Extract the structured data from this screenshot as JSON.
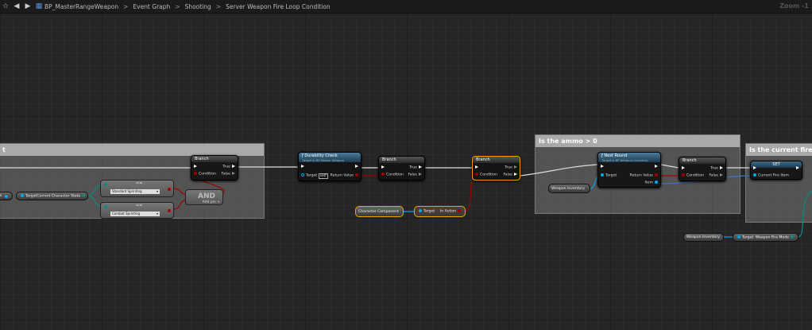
{
  "toolbar": {
    "breadcrumb": [
      "BP_MasterRangeWeapon",
      "Event Graph",
      "Shooting",
      "Server Weapon Fire Loop Condition"
    ],
    "zoom": "Zoom -1"
  },
  "comments": [
    {
      "title": "t"
    },
    {
      "title": "Is the ammo > 0"
    },
    {
      "title": "Is the current fire on"
    }
  ],
  "nodes": {
    "branch": {
      "title": "Branch",
      "condition": "Condition",
      "true": "True",
      "false": "False"
    },
    "var_cut": "rs",
    "get_state": {
      "target": "Target",
      "out": "Current Character State"
    },
    "eq1": {
      "symbol": "==",
      "value": "Standard Sprinting"
    },
    "eq2": {
      "symbol": "==",
      "value": "Combat Sprinting"
    },
    "and": {
      "title": "AND",
      "add_pin": "Add pin"
    },
    "durability": {
      "title": "Durability Check",
      "subtitle": "Target is BP Master Weapon",
      "target": "Target",
      "self": "self",
      "ret": "Return Value"
    },
    "char_comp": "Character Component",
    "in_action": {
      "target": "Target",
      "out": "In Action"
    },
    "next_round": {
      "title": "Next Round",
      "subtitle": "Target is BP Weapon Inventory",
      "target": "Target",
      "ret": "Return Value",
      "item": "Item"
    },
    "weapon_inventory": "Weapon Inventory",
    "set": {
      "title": "SET",
      "pin": "Current Fire Item"
    },
    "fire_mode": {
      "target": "Target",
      "out": "Weapon Fire Mode"
    }
  },
  "colors": {
    "exec": "#ffffff",
    "bool": "#a00000",
    "object": "#00a8f0",
    "enum": "#006f65",
    "selected": "#f0a000"
  }
}
